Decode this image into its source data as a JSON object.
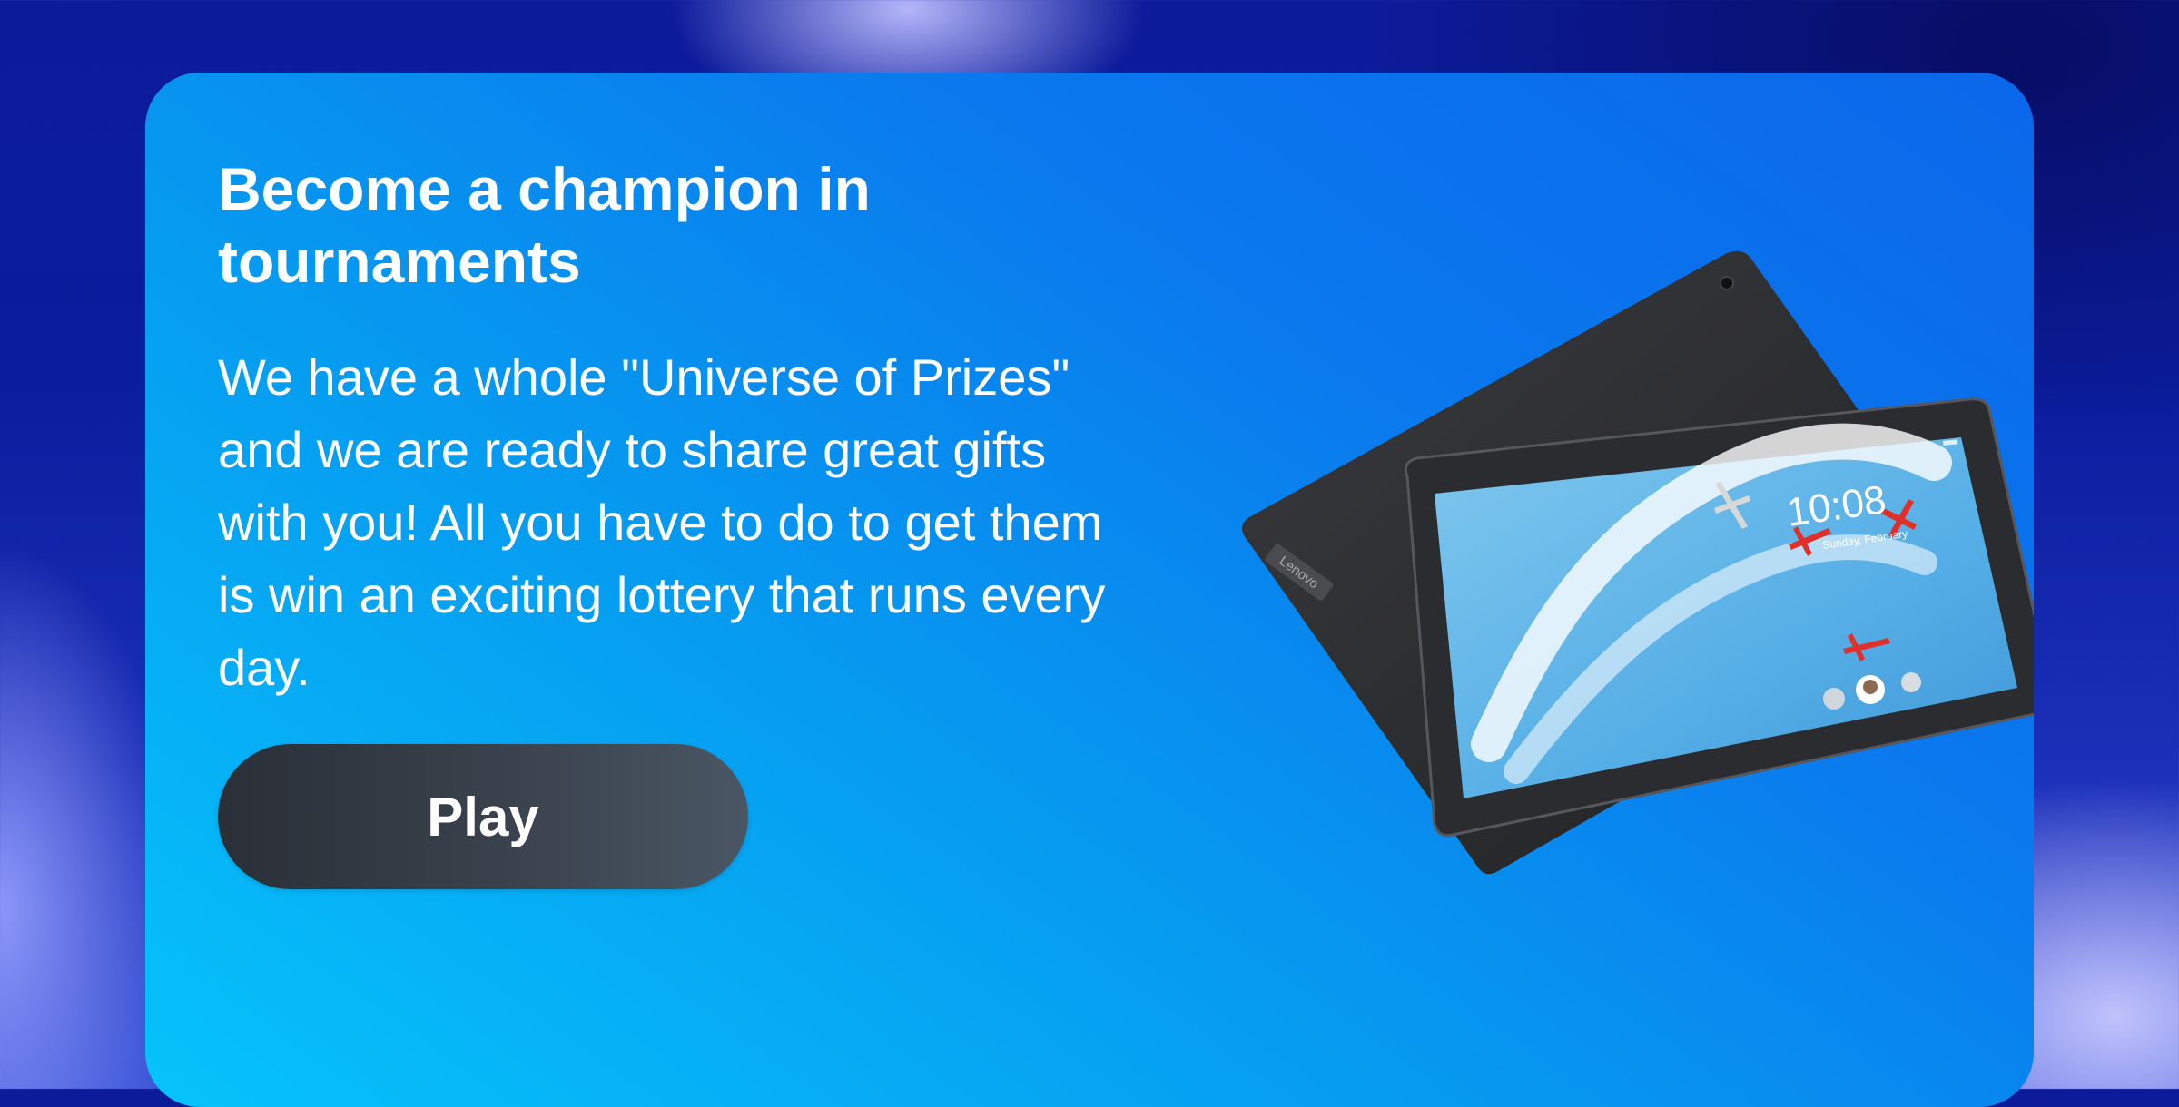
{
  "promo": {
    "title": "Become a champion in tournaments",
    "description": "We have a whole \"Universe of Prizes\" and we are ready to share great gifts with you! All you have to do to get them is win an exciting lottery that runs every day.",
    "play_label": "Play"
  },
  "tablet": {
    "clock": "10:08",
    "date": "Sunday, February",
    "brand": "Lenovo"
  },
  "colors": {
    "card_start": "#06c3fb",
    "card_end": "#0b67ea",
    "button": "#2f3640",
    "text": "#ffffff"
  }
}
